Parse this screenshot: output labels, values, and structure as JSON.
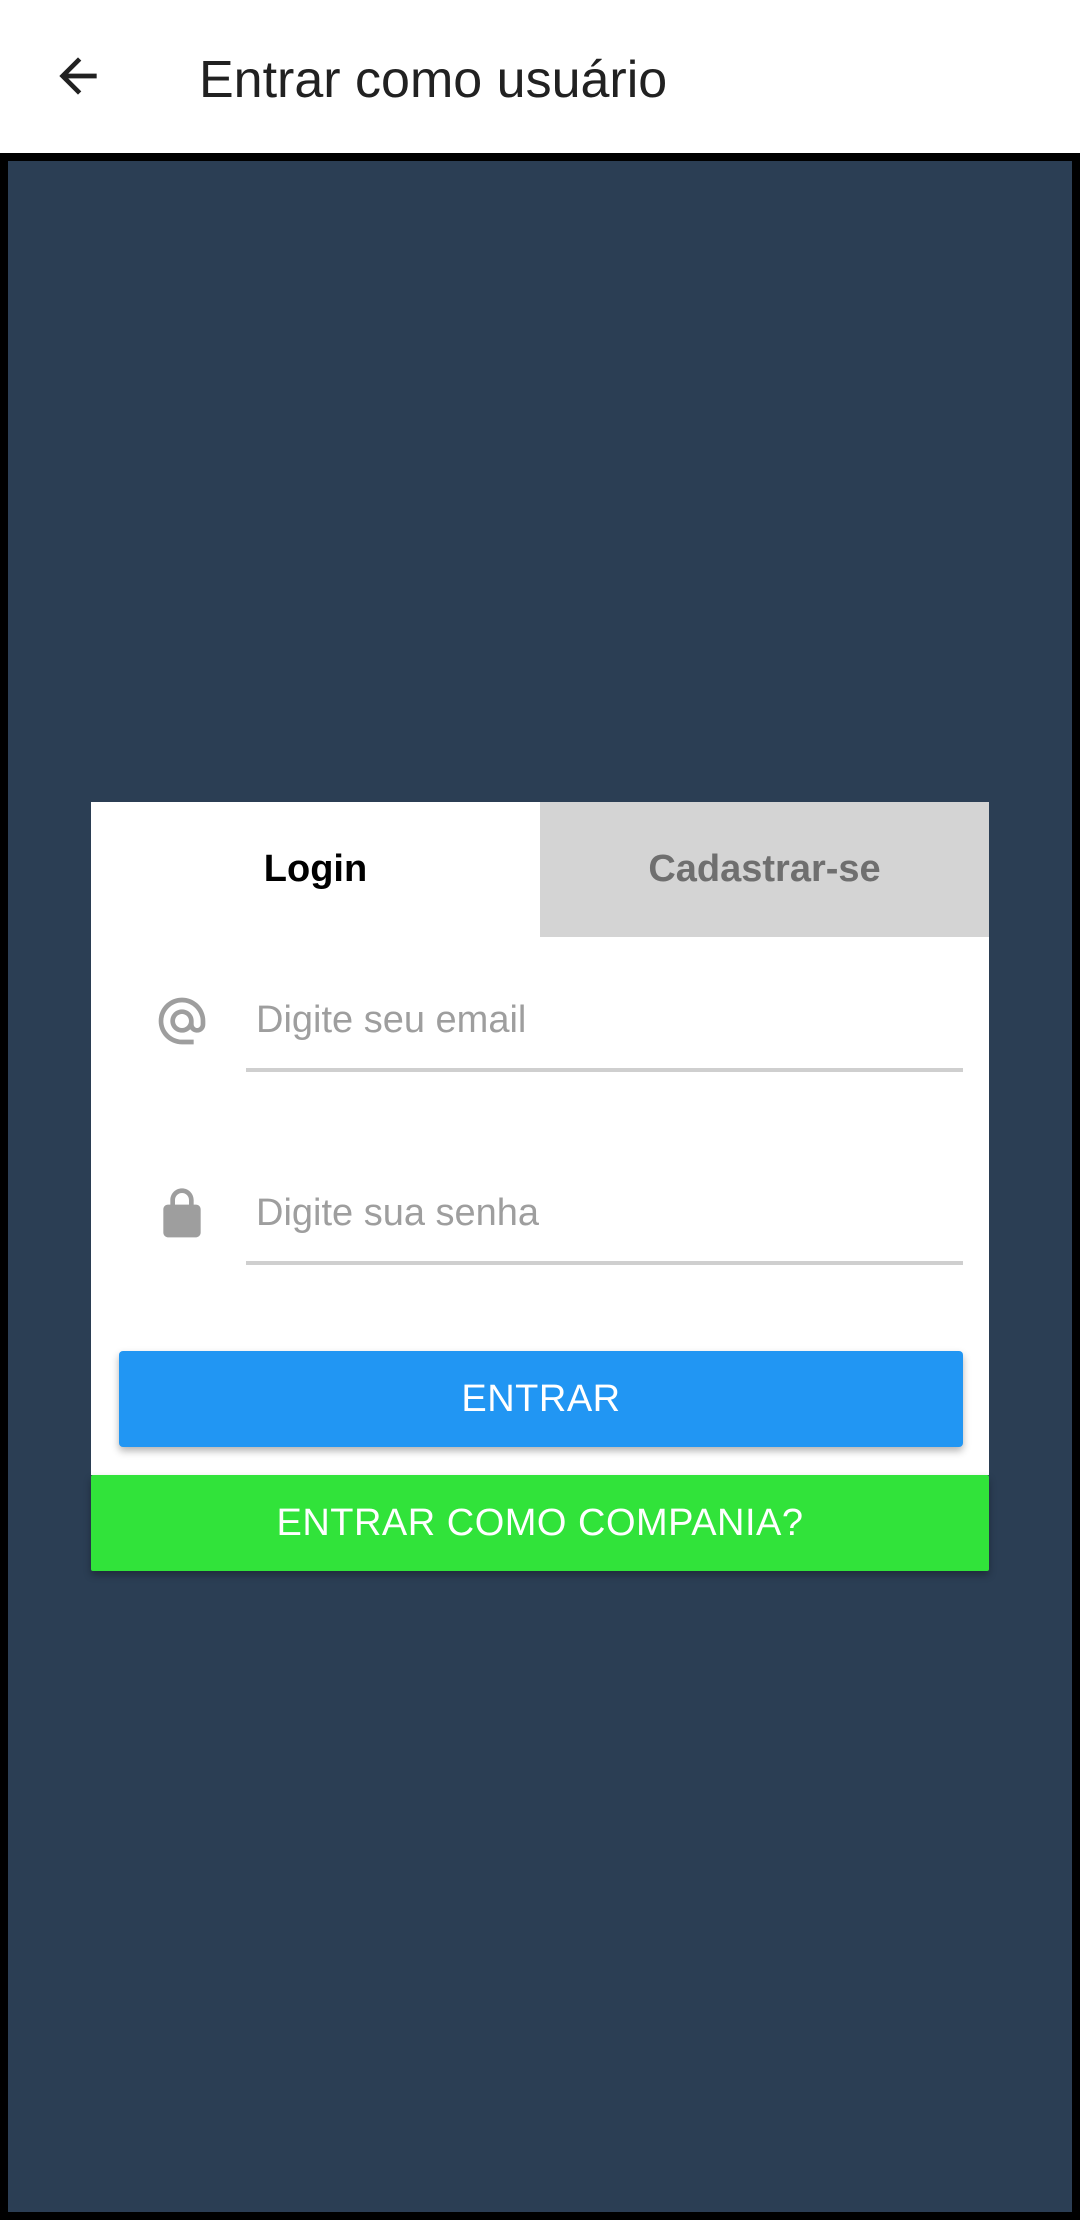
{
  "appbar": {
    "back_icon": "arrow-back-icon",
    "title": "Entrar como usuário"
  },
  "tabs": [
    {
      "label": "Login",
      "active": true
    },
    {
      "label": "Cadastrar-se",
      "active": false
    }
  ],
  "form": {
    "email": {
      "icon": "at-sign-icon",
      "placeholder": "Digite seu email",
      "value": ""
    },
    "password": {
      "icon": "lock-icon",
      "placeholder": "Digite sua senha",
      "value": ""
    },
    "submit_label": "ENTRAR"
  },
  "company_button": {
    "label": "ENTRAR COMO COMPANIA?"
  },
  "colors": {
    "background": "#2b3e54",
    "primary": "#2196f3",
    "accent": "#31e33a",
    "inactive_tab": "#d4d4d4"
  }
}
